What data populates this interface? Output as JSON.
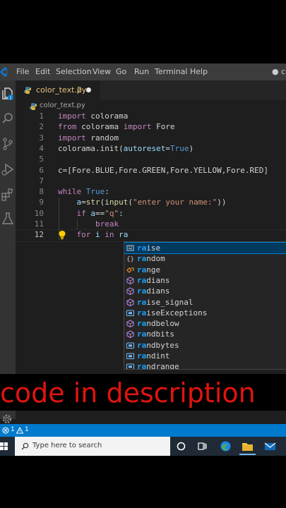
{
  "menubar": {
    "items": [
      "File",
      "Edit",
      "Selection",
      "View",
      "Go",
      "Run",
      "Terminal",
      "Help"
    ],
    "window_title": "● co"
  },
  "activitybar": {
    "explorer_badge": "1",
    "icons": [
      "files-icon",
      "search-icon",
      "source-control-icon",
      "run-debug-icon",
      "extensions-icon",
      "testing-icon"
    ]
  },
  "tab": {
    "filename": "color_text.py",
    "problem_count": "2",
    "modified": true
  },
  "breadcrumb": {
    "file": "color_text.py"
  },
  "editor": {
    "lines": [
      {
        "num": "1",
        "tokens": [
          {
            "t": "import",
            "c": "kw"
          },
          {
            "t": " colorama",
            "c": "plain"
          }
        ]
      },
      {
        "num": "2",
        "tokens": [
          {
            "t": "from",
            "c": "kw"
          },
          {
            "t": " colorama ",
            "c": "plain"
          },
          {
            "t": "import",
            "c": "kw"
          },
          {
            "t": " Fore",
            "c": "plain"
          }
        ]
      },
      {
        "num": "3",
        "tokens": [
          {
            "t": "import",
            "c": "kw"
          },
          {
            "t": " random",
            "c": "plain"
          }
        ]
      },
      {
        "num": "4",
        "tokens": [
          {
            "t": "colorama.init(",
            "c": "plain"
          },
          {
            "t": "autoreset",
            "c": "var"
          },
          {
            "t": "=",
            "c": "plain"
          },
          {
            "t": "True",
            "c": "cn"
          },
          {
            "t": ")",
            "c": "plain"
          }
        ]
      },
      {
        "num": "5",
        "tokens": []
      },
      {
        "num": "6",
        "tokens": [
          {
            "t": "c=[Fore.BLUE,Fore.GREEN,Fore.YELLOW,Fore.RED]",
            "c": "plain"
          }
        ]
      },
      {
        "num": "7",
        "tokens": []
      },
      {
        "num": "8",
        "tokens": [
          {
            "t": "while",
            "c": "kw"
          },
          {
            "t": " ",
            "c": "plain"
          },
          {
            "t": "True",
            "c": "cn"
          },
          {
            "t": ":",
            "c": "plain"
          }
        ]
      },
      {
        "num": "9",
        "tokens": [
          {
            "t": "    ",
            "c": "plain"
          },
          {
            "t": "a",
            "c": "var"
          },
          {
            "t": "=",
            "c": "plain"
          },
          {
            "t": "str",
            "c": "fn"
          },
          {
            "t": "(",
            "c": "plain"
          },
          {
            "t": "input",
            "c": "fn"
          },
          {
            "t": "(",
            "c": "plain"
          },
          {
            "t": "\"enter your name:\"",
            "c": "st"
          },
          {
            "t": "))",
            "c": "plain"
          }
        ]
      },
      {
        "num": "10",
        "tokens": [
          {
            "t": "    ",
            "c": "plain"
          },
          {
            "t": "if",
            "c": "kw"
          },
          {
            "t": " ",
            "c": "plain"
          },
          {
            "t": "a",
            "c": "var"
          },
          {
            "t": "==",
            "c": "plain"
          },
          {
            "t": "\"q\"",
            "c": "st"
          },
          {
            "t": ":",
            "c": "plain"
          }
        ]
      },
      {
        "num": "11",
        "tokens": [
          {
            "t": "        ",
            "c": "plain"
          },
          {
            "t": "break",
            "c": "kw"
          }
        ]
      },
      {
        "num": "12",
        "tokens": [
          {
            "t": "    ",
            "c": "plain"
          },
          {
            "t": "for",
            "c": "kw"
          },
          {
            "t": " ",
            "c": "plain"
          },
          {
            "t": "i",
            "c": "var"
          },
          {
            "t": " ",
            "c": "plain"
          },
          {
            "t": "in",
            "c": "kw"
          },
          {
            "t": " ",
            "c": "plain"
          },
          {
            "t": "ra",
            "c": "var"
          }
        ]
      }
    ]
  },
  "suggestions": [
    {
      "label": "raise",
      "kind": "keyword-icon"
    },
    {
      "label": "random",
      "kind": "module-icon"
    },
    {
      "label": "range",
      "kind": "class-icon"
    },
    {
      "label": "radians",
      "kind": "method-icon"
    },
    {
      "label": "radians",
      "kind": "method-icon"
    },
    {
      "label": "raise_signal",
      "kind": "method-icon"
    },
    {
      "label": "raiseExceptions",
      "kind": "variable-icon"
    },
    {
      "label": "randbelow",
      "kind": "method-icon"
    },
    {
      "label": "randbits",
      "kind": "method-icon"
    },
    {
      "label": "randbytes",
      "kind": "variable-icon"
    },
    {
      "label": "randint",
      "kind": "variable-icon"
    },
    {
      "label": "randrange",
      "kind": "variable-icon"
    }
  ],
  "banner": {
    "text": "code in description"
  },
  "statusbar": {
    "errors": "1",
    "warnings": "1"
  },
  "taskbar": {
    "search_placeholder": "Type here to search"
  },
  "colors": {
    "accent": "#007acc",
    "banner_text": "#e0140f"
  }
}
